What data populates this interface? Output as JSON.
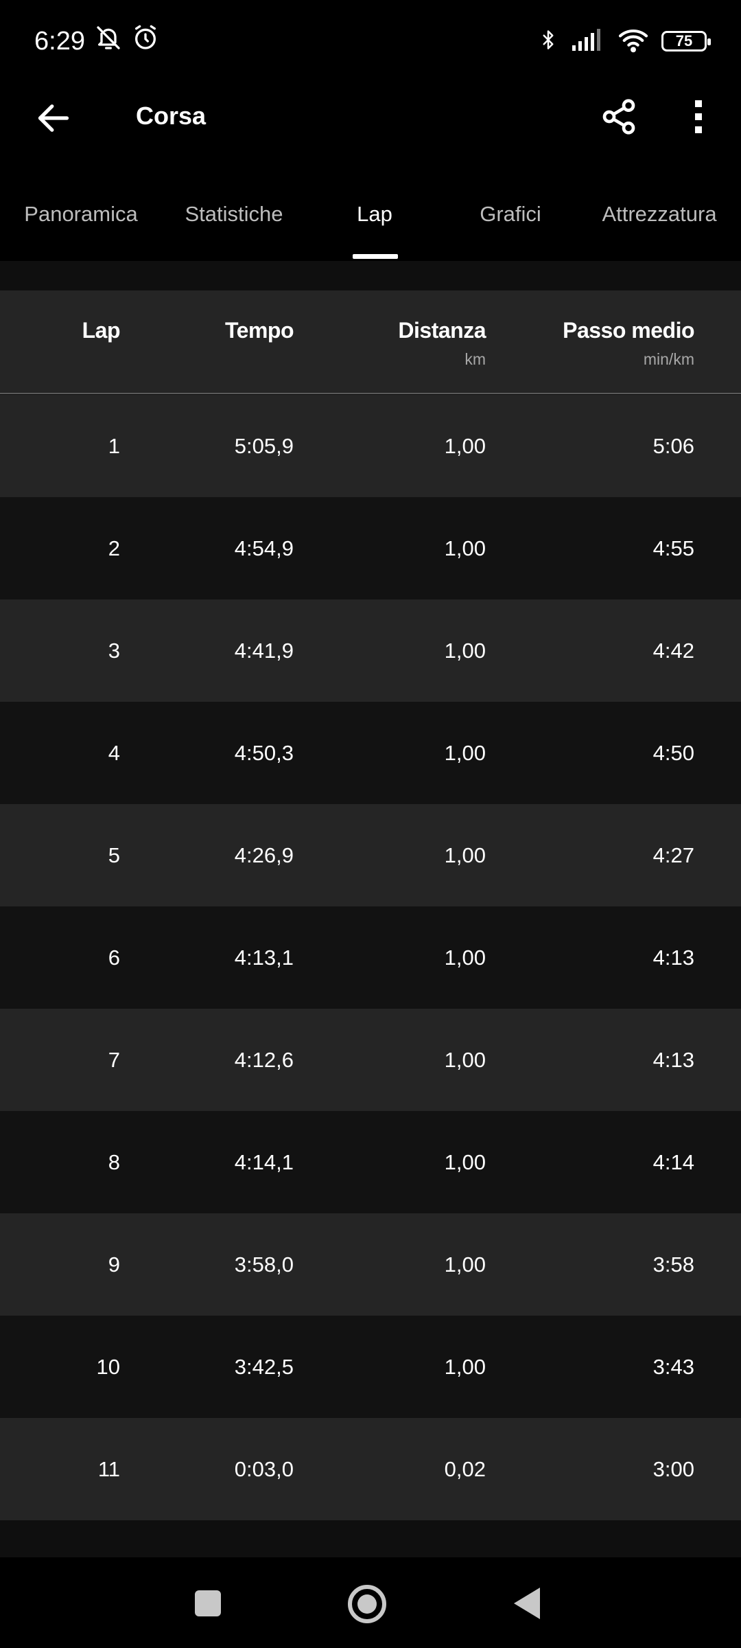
{
  "status": {
    "time": "6:29",
    "battery": "75"
  },
  "app": {
    "title": "Corsa"
  },
  "tabs": [
    {
      "label": "Panoramica"
    },
    {
      "label": "Statistiche"
    },
    {
      "label": "Lap"
    },
    {
      "label": "Grafici"
    },
    {
      "label": "Attrezzatura"
    }
  ],
  "active_tab": "Lap",
  "table": {
    "headers": {
      "lap": "Lap",
      "tempo": "Tempo",
      "distanza": "Distanza",
      "distanza_unit": "km",
      "passo": "Passo medio",
      "passo_unit": "min/km"
    },
    "rows": [
      {
        "lap": "1",
        "tempo": "5:05,9",
        "distanza": "1,00",
        "passo": "5:06"
      },
      {
        "lap": "2",
        "tempo": "4:54,9",
        "distanza": "1,00",
        "passo": "4:55"
      },
      {
        "lap": "3",
        "tempo": "4:41,9",
        "distanza": "1,00",
        "passo": "4:42"
      },
      {
        "lap": "4",
        "tempo": "4:50,3",
        "distanza": "1,00",
        "passo": "4:50"
      },
      {
        "lap": "5",
        "tempo": "4:26,9",
        "distanza": "1,00",
        "passo": "4:27"
      },
      {
        "lap": "6",
        "tempo": "4:13,1",
        "distanza": "1,00",
        "passo": "4:13"
      },
      {
        "lap": "7",
        "tempo": "4:12,6",
        "distanza": "1,00",
        "passo": "4:13"
      },
      {
        "lap": "8",
        "tempo": "4:14,1",
        "distanza": "1,00",
        "passo": "4:14"
      },
      {
        "lap": "9",
        "tempo": "3:58,0",
        "distanza": "1,00",
        "passo": "3:58"
      },
      {
        "lap": "10",
        "tempo": "3:42,5",
        "distanza": "1,00",
        "passo": "3:43"
      },
      {
        "lap": "11",
        "tempo": "0:03,0",
        "distanza": "0,02",
        "passo": "3:00"
      }
    ]
  }
}
